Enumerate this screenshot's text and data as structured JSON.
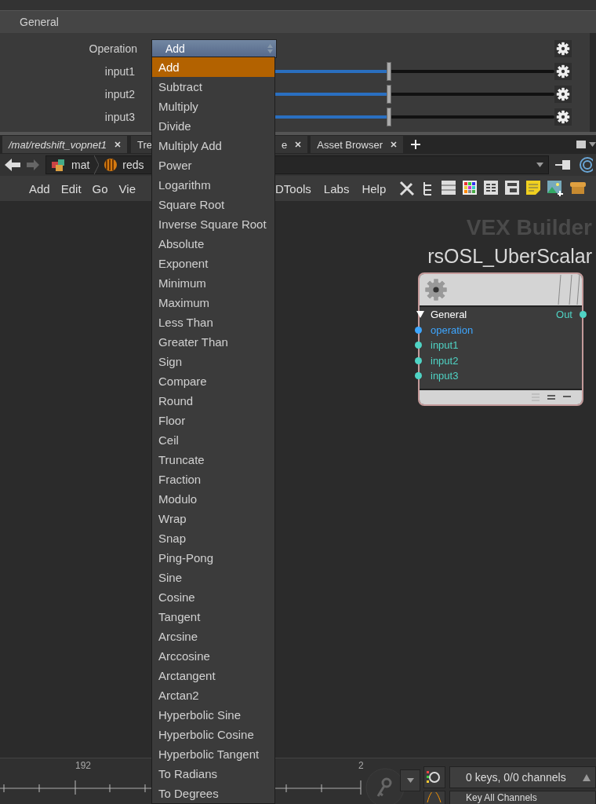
{
  "parameters": {
    "section": "General",
    "rows": [
      {
        "kind": "menu",
        "label": "Operation",
        "value": "Add"
      },
      {
        "kind": "slider",
        "label": "input1",
        "level": 0.59
      },
      {
        "kind": "slider",
        "label": "input2",
        "level": 0.59
      },
      {
        "kind": "slider",
        "label": "input3",
        "level": 0.59
      }
    ]
  },
  "pane_tabs": [
    {
      "label": "/mat/redshift_vopnet1",
      "closable": true,
      "selected": true
    },
    {
      "label": "Tre",
      "closable": false,
      "selected": false
    },
    {
      "label": "e",
      "closable": true,
      "selected": false
    },
    {
      "label": "Asset Browser",
      "closable": true,
      "selected": false
    }
  ],
  "path_bar": {
    "crumbs": [
      "mat",
      "reds"
    ]
  },
  "menubar": {
    "left": [
      "Add",
      "Edit",
      "Go",
      "Vie"
    ],
    "right": [
      "DTools",
      "Labs",
      "Help"
    ]
  },
  "network": {
    "context": "VEX Builder",
    "node": {
      "name": "rsOSL_UberScalar",
      "section": "General",
      "output": "Out",
      "inputs": [
        {
          "name": "operation",
          "color": "#3ea6ff"
        },
        {
          "name": "input1",
          "color": "#4fd3c4"
        },
        {
          "name": "input2",
          "color": "#4fd3c4"
        },
        {
          "name": "input3",
          "color": "#4fd3c4"
        }
      ]
    }
  },
  "timeline": {
    "frame_labels": [
      "192",
      "2"
    ],
    "channels_field": "0 keys, 0/0 channels",
    "key_mode": "Key All Channels"
  },
  "operation_menu": {
    "items": [
      {
        "label": "Add",
        "selected": true
      },
      {
        "label": "Subtract",
        "selected": false
      },
      {
        "label": "Multiply",
        "selected": false
      },
      {
        "label": "Divide",
        "selected": false
      },
      {
        "label": "Multiply Add",
        "selected": false
      },
      {
        "label": "Power",
        "selected": false
      },
      {
        "label": "Logarithm",
        "selected": false
      },
      {
        "label": "Square Root",
        "selected": false
      },
      {
        "label": "Inverse Square Root",
        "selected": false
      },
      {
        "label": "Absolute",
        "selected": false
      },
      {
        "label": "Exponent",
        "selected": false
      },
      {
        "label": "Minimum",
        "selected": false
      },
      {
        "label": "Maximum",
        "selected": false
      },
      {
        "label": "Less Than",
        "selected": false
      },
      {
        "label": "Greater Than",
        "selected": false
      },
      {
        "label": "Sign",
        "selected": false
      },
      {
        "label": "Compare",
        "selected": false
      },
      {
        "label": "Round",
        "selected": false
      },
      {
        "label": "Floor",
        "selected": false
      },
      {
        "label": "Ceil",
        "selected": false
      },
      {
        "label": "Truncate",
        "selected": false
      },
      {
        "label": "Fraction",
        "selected": false
      },
      {
        "label": "Modulo",
        "selected": false
      },
      {
        "label": "Wrap",
        "selected": false
      },
      {
        "label": "Snap",
        "selected": false
      },
      {
        "label": "Ping-Pong",
        "selected": false
      },
      {
        "label": "Sine",
        "selected": false
      },
      {
        "label": "Cosine",
        "selected": false
      },
      {
        "label": "Tangent",
        "selected": false
      },
      {
        "label": "Arcsine",
        "selected": false
      },
      {
        "label": "Arccosine",
        "selected": false
      },
      {
        "label": "Arctangent",
        "selected": false
      },
      {
        "label": "Arctan2",
        "selected": false
      },
      {
        "label": "Hyperbolic Sine",
        "selected": false
      },
      {
        "label": "Hyperbolic Cosine",
        "selected": false
      },
      {
        "label": "Hyperbolic Tangent",
        "selected": false
      },
      {
        "label": "To Radians",
        "selected": false
      },
      {
        "label": "To Degrees",
        "selected": false
      }
    ]
  }
}
